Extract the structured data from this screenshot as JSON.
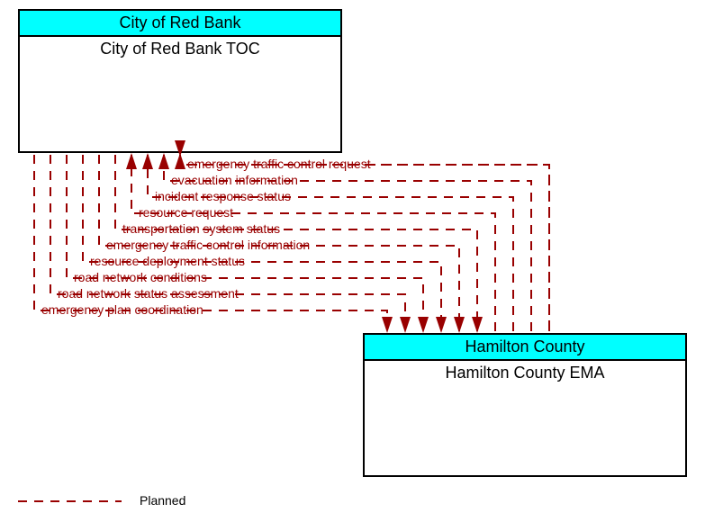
{
  "box1": {
    "header": "City of Red Bank",
    "title": "City of Red Bank TOC"
  },
  "box2": {
    "header": "Hamilton County",
    "title": "Hamilton County EMA"
  },
  "flows": {
    "f0": "emergency traffic control request",
    "f1": "evacuation information",
    "f2": "incident response status",
    "f3": "resource request",
    "f4": "transportation system status",
    "f5": "emergency traffic control information",
    "f6": "resource deployment status",
    "f7": "road network conditions",
    "f8": "road network status assessment",
    "f9": "emergency plan coordination"
  },
  "legend": {
    "planned": "Planned"
  }
}
